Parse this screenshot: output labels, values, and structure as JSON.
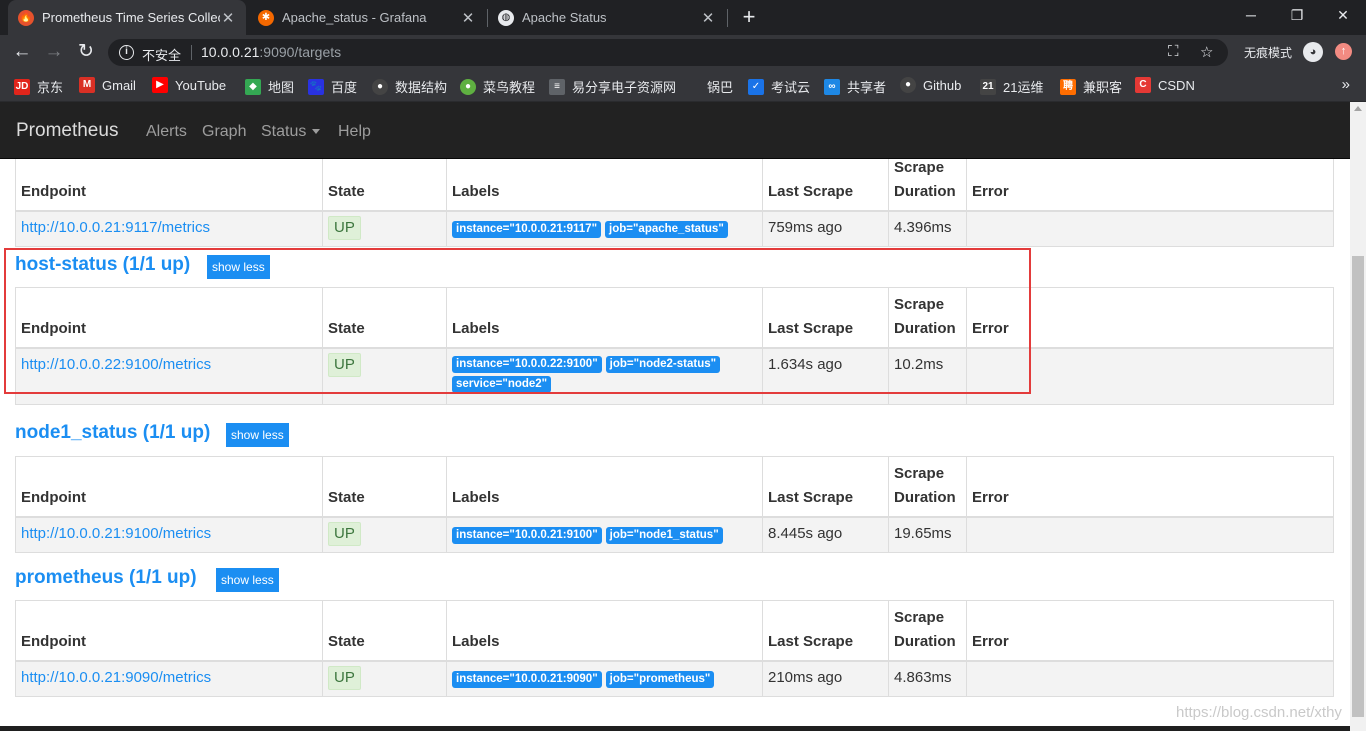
{
  "browser": {
    "tabs": [
      {
        "title": "Prometheus Time Series Collection",
        "active": true
      },
      {
        "title": "Apache_status - Grafana",
        "active": false
      },
      {
        "title": "Apache Status",
        "active": false
      }
    ],
    "new_tab": "+",
    "window_controls": {
      "minimize": "─",
      "maximize": "❐",
      "close": "✕"
    },
    "nav": {
      "back": "←",
      "forward": "→",
      "reload": "↻"
    },
    "security_text": "不安全",
    "url_host": "10.0.0.21",
    "url_path": ":9090/targets",
    "incognito_text": "无痕模式",
    "bookmarks": [
      {
        "label": "京东",
        "icon": "JD",
        "color": "#e1251b"
      },
      {
        "label": "Gmail",
        "icon": "M",
        "color": "#d93025"
      },
      {
        "label": "YouTube",
        "icon": "▶",
        "color": "#ff0000"
      },
      {
        "label": "地图",
        "icon": "◆",
        "color": "#34a853"
      },
      {
        "label": "百度",
        "icon": "🐾",
        "color": "#2932e1"
      },
      {
        "label": "数据结构",
        "icon": "●",
        "color": "#444444"
      },
      {
        "label": "菜鸟教程",
        "icon": "●",
        "color": "#5fb041"
      },
      {
        "label": "易分享电子资源网",
        "icon": "≡",
        "color": "#5f6368"
      },
      {
        "label": "锅巴",
        "icon": "",
        "color": "#35363a"
      },
      {
        "label": "考试云",
        "icon": "✓",
        "color": "#1a73e8"
      },
      {
        "label": "共享者",
        "icon": "∞",
        "color": "#1e88e5"
      },
      {
        "label": "Github",
        "icon": "●",
        "color": "#444444"
      },
      {
        "label": "21运维",
        "icon": "21",
        "color": "#444444"
      },
      {
        "label": "兼职客",
        "icon": "聘",
        "color": "#ff6d00"
      },
      {
        "label": "CSDN",
        "icon": "C",
        "color": "#e53935"
      }
    ],
    "more": "»"
  },
  "app": {
    "brand": "Prometheus",
    "nav": [
      "Alerts",
      "Graph",
      "Status",
      "Help"
    ]
  },
  "columns": [
    "Endpoint",
    "State",
    "Labels",
    "Last Scrape",
    "Scrape Duration",
    "Error"
  ],
  "column_scrape_line1": "Scrape",
  "column_scrape_line2": "Duration",
  "show_less": "show less",
  "jobs": [
    {
      "title": "",
      "endpoint": "http://10.0.0.21:9117/metrics",
      "state": "UP",
      "labels": [
        "instance=\"10.0.0.21:9117\"",
        "job=\"apache_status\""
      ],
      "last_scrape": "759ms ago",
      "duration": "4.396ms",
      "error": ""
    },
    {
      "title": "host-status (1/1 up)",
      "endpoint": "http://10.0.0.22:9100/metrics",
      "state": "UP",
      "labels": [
        "instance=\"10.0.0.22:9100\"",
        "job=\"node2-status\"",
        "service=\"node2\""
      ],
      "last_scrape": "1.634s ago",
      "duration": "10.2ms",
      "error": ""
    },
    {
      "title": "node1_status (1/1 up)",
      "endpoint": "http://10.0.0.21:9100/metrics",
      "state": "UP",
      "labels": [
        "instance=\"10.0.0.21:9100\"",
        "job=\"node1_status\""
      ],
      "last_scrape": "8.445s ago",
      "duration": "19.65ms",
      "error": ""
    },
    {
      "title": "prometheus (1/1 up)",
      "endpoint": "http://10.0.0.21:9090/metrics",
      "state": "UP",
      "labels": [
        "instance=\"10.0.0.21:9090\"",
        "job=\"prometheus\""
      ],
      "last_scrape": "210ms ago",
      "duration": "4.863ms",
      "error": ""
    }
  ],
  "watermark": "https://blog.csdn.net/xthy",
  "colors": {
    "accent": "#1b8ef2",
    "up_bg": "#dff0d8",
    "up_text": "#3c763d",
    "highlight": "#e33b3b",
    "navbar": "#222222"
  }
}
